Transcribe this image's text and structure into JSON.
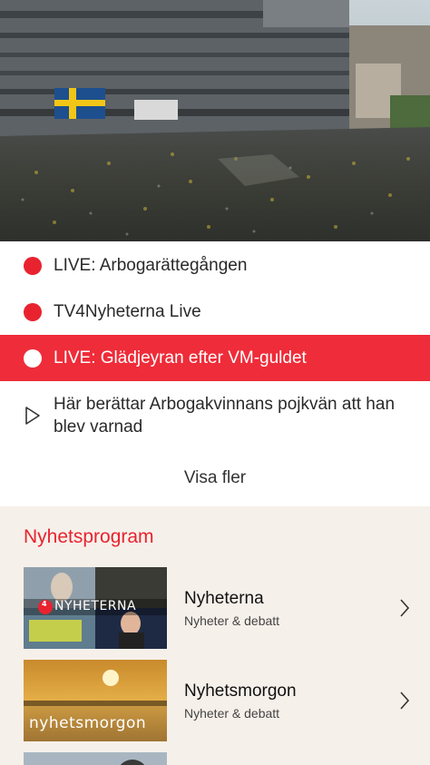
{
  "live_list": {
    "items": [
      {
        "type": "live",
        "label": "LIVE: Arbogarättegången",
        "active": false
      },
      {
        "type": "live",
        "label": "TV4Nyheterna Live",
        "active": false
      },
      {
        "type": "live",
        "label": "LIVE: Glädjeyran efter VM-guldet",
        "active": true
      },
      {
        "type": "video",
        "label": "Här berättar Arbogakvinnans pojkvän att han blev varnad",
        "active": false
      }
    ],
    "show_more_label": "Visa fler"
  },
  "programs": {
    "title": "Nyhetsprogram",
    "items": [
      {
        "title": "Nyheterna",
        "subtitle": "Nyheter & debatt",
        "thumb_text": "NYHETERNA",
        "thumb_badge": "4"
      },
      {
        "title": "Nyhetsmorgon",
        "subtitle": "Nyheter & debatt",
        "thumb_text": "nyhetsmorgon"
      }
    ]
  },
  "colors": {
    "accent": "#e8232f",
    "active_row": "#ef2c39",
    "section_bg": "#f6f0ea"
  },
  "icons": [
    "live-dot-icon",
    "play-icon",
    "chevron-right-icon"
  ]
}
